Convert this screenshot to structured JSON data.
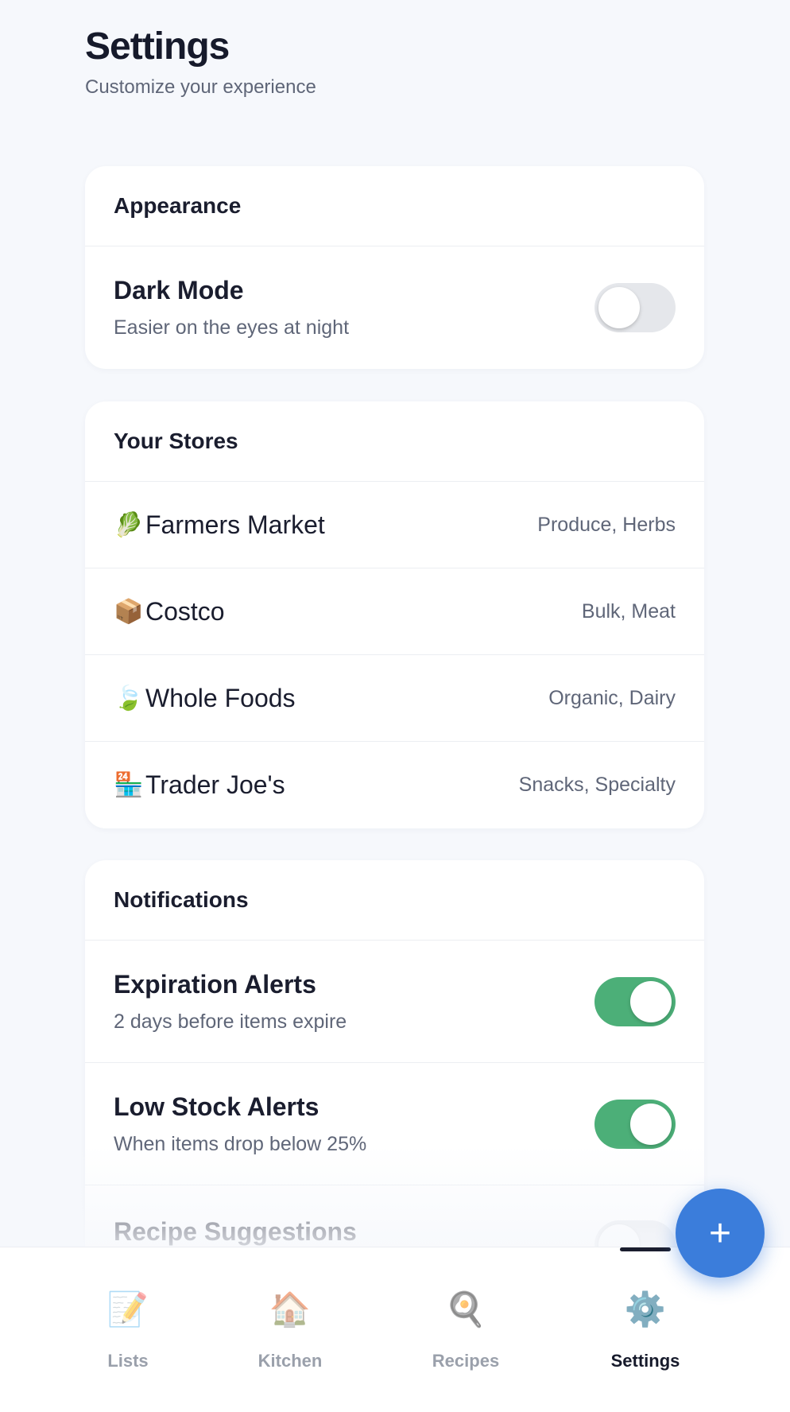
{
  "header": {
    "title": "Settings",
    "subtitle": "Customize your experience"
  },
  "appearance": {
    "section_title": "Appearance",
    "dark_mode": {
      "title": "Dark Mode",
      "description": "Easier on the eyes at night",
      "enabled": false
    }
  },
  "stores": {
    "section_title": "Your Stores",
    "items": [
      {
        "icon": "🥬",
        "icon_name": "leafy-greens-icon",
        "name": "Farmers Market",
        "tags": "Produce, Herbs"
      },
      {
        "icon": "📦",
        "icon_name": "package-icon",
        "name": "Costco",
        "tags": "Bulk, Meat"
      },
      {
        "icon": "🍃",
        "icon_name": "leaf-icon",
        "name": "Whole Foods",
        "tags": "Organic, Dairy"
      },
      {
        "icon": "🏪",
        "icon_name": "convenience-store-icon",
        "name": "Trader Joe's",
        "tags": "Snacks, Specialty"
      }
    ]
  },
  "notifications": {
    "section_title": "Notifications",
    "items": [
      {
        "title": "Expiration Alerts",
        "description": "2 days before items expire",
        "enabled": true
      },
      {
        "title": "Low Stock Alerts",
        "description": "When items drop below 25%",
        "enabled": true
      },
      {
        "title": "Recipe Suggestions",
        "description": "",
        "enabled": false
      }
    ]
  },
  "fab": {
    "label": "+",
    "icon_name": "plus-icon"
  },
  "tabbar": {
    "tabs": [
      {
        "icon": "📝",
        "icon_name": "memo-icon",
        "label": "Lists"
      },
      {
        "icon": "🏠",
        "icon_name": "house-icon",
        "label": "Kitchen"
      },
      {
        "icon": "🍳",
        "icon_name": "frying-pan-icon",
        "label": "Recipes"
      },
      {
        "icon": "⚙️",
        "icon_name": "gear-icon",
        "label": "Settings"
      }
    ],
    "active_tab": "Settings"
  },
  "colors": {
    "accent": "#3b7ddb",
    "toggle_on": "#4caf78",
    "toggle_off": "#e5e7eb",
    "background": "#f6f8fc"
  }
}
